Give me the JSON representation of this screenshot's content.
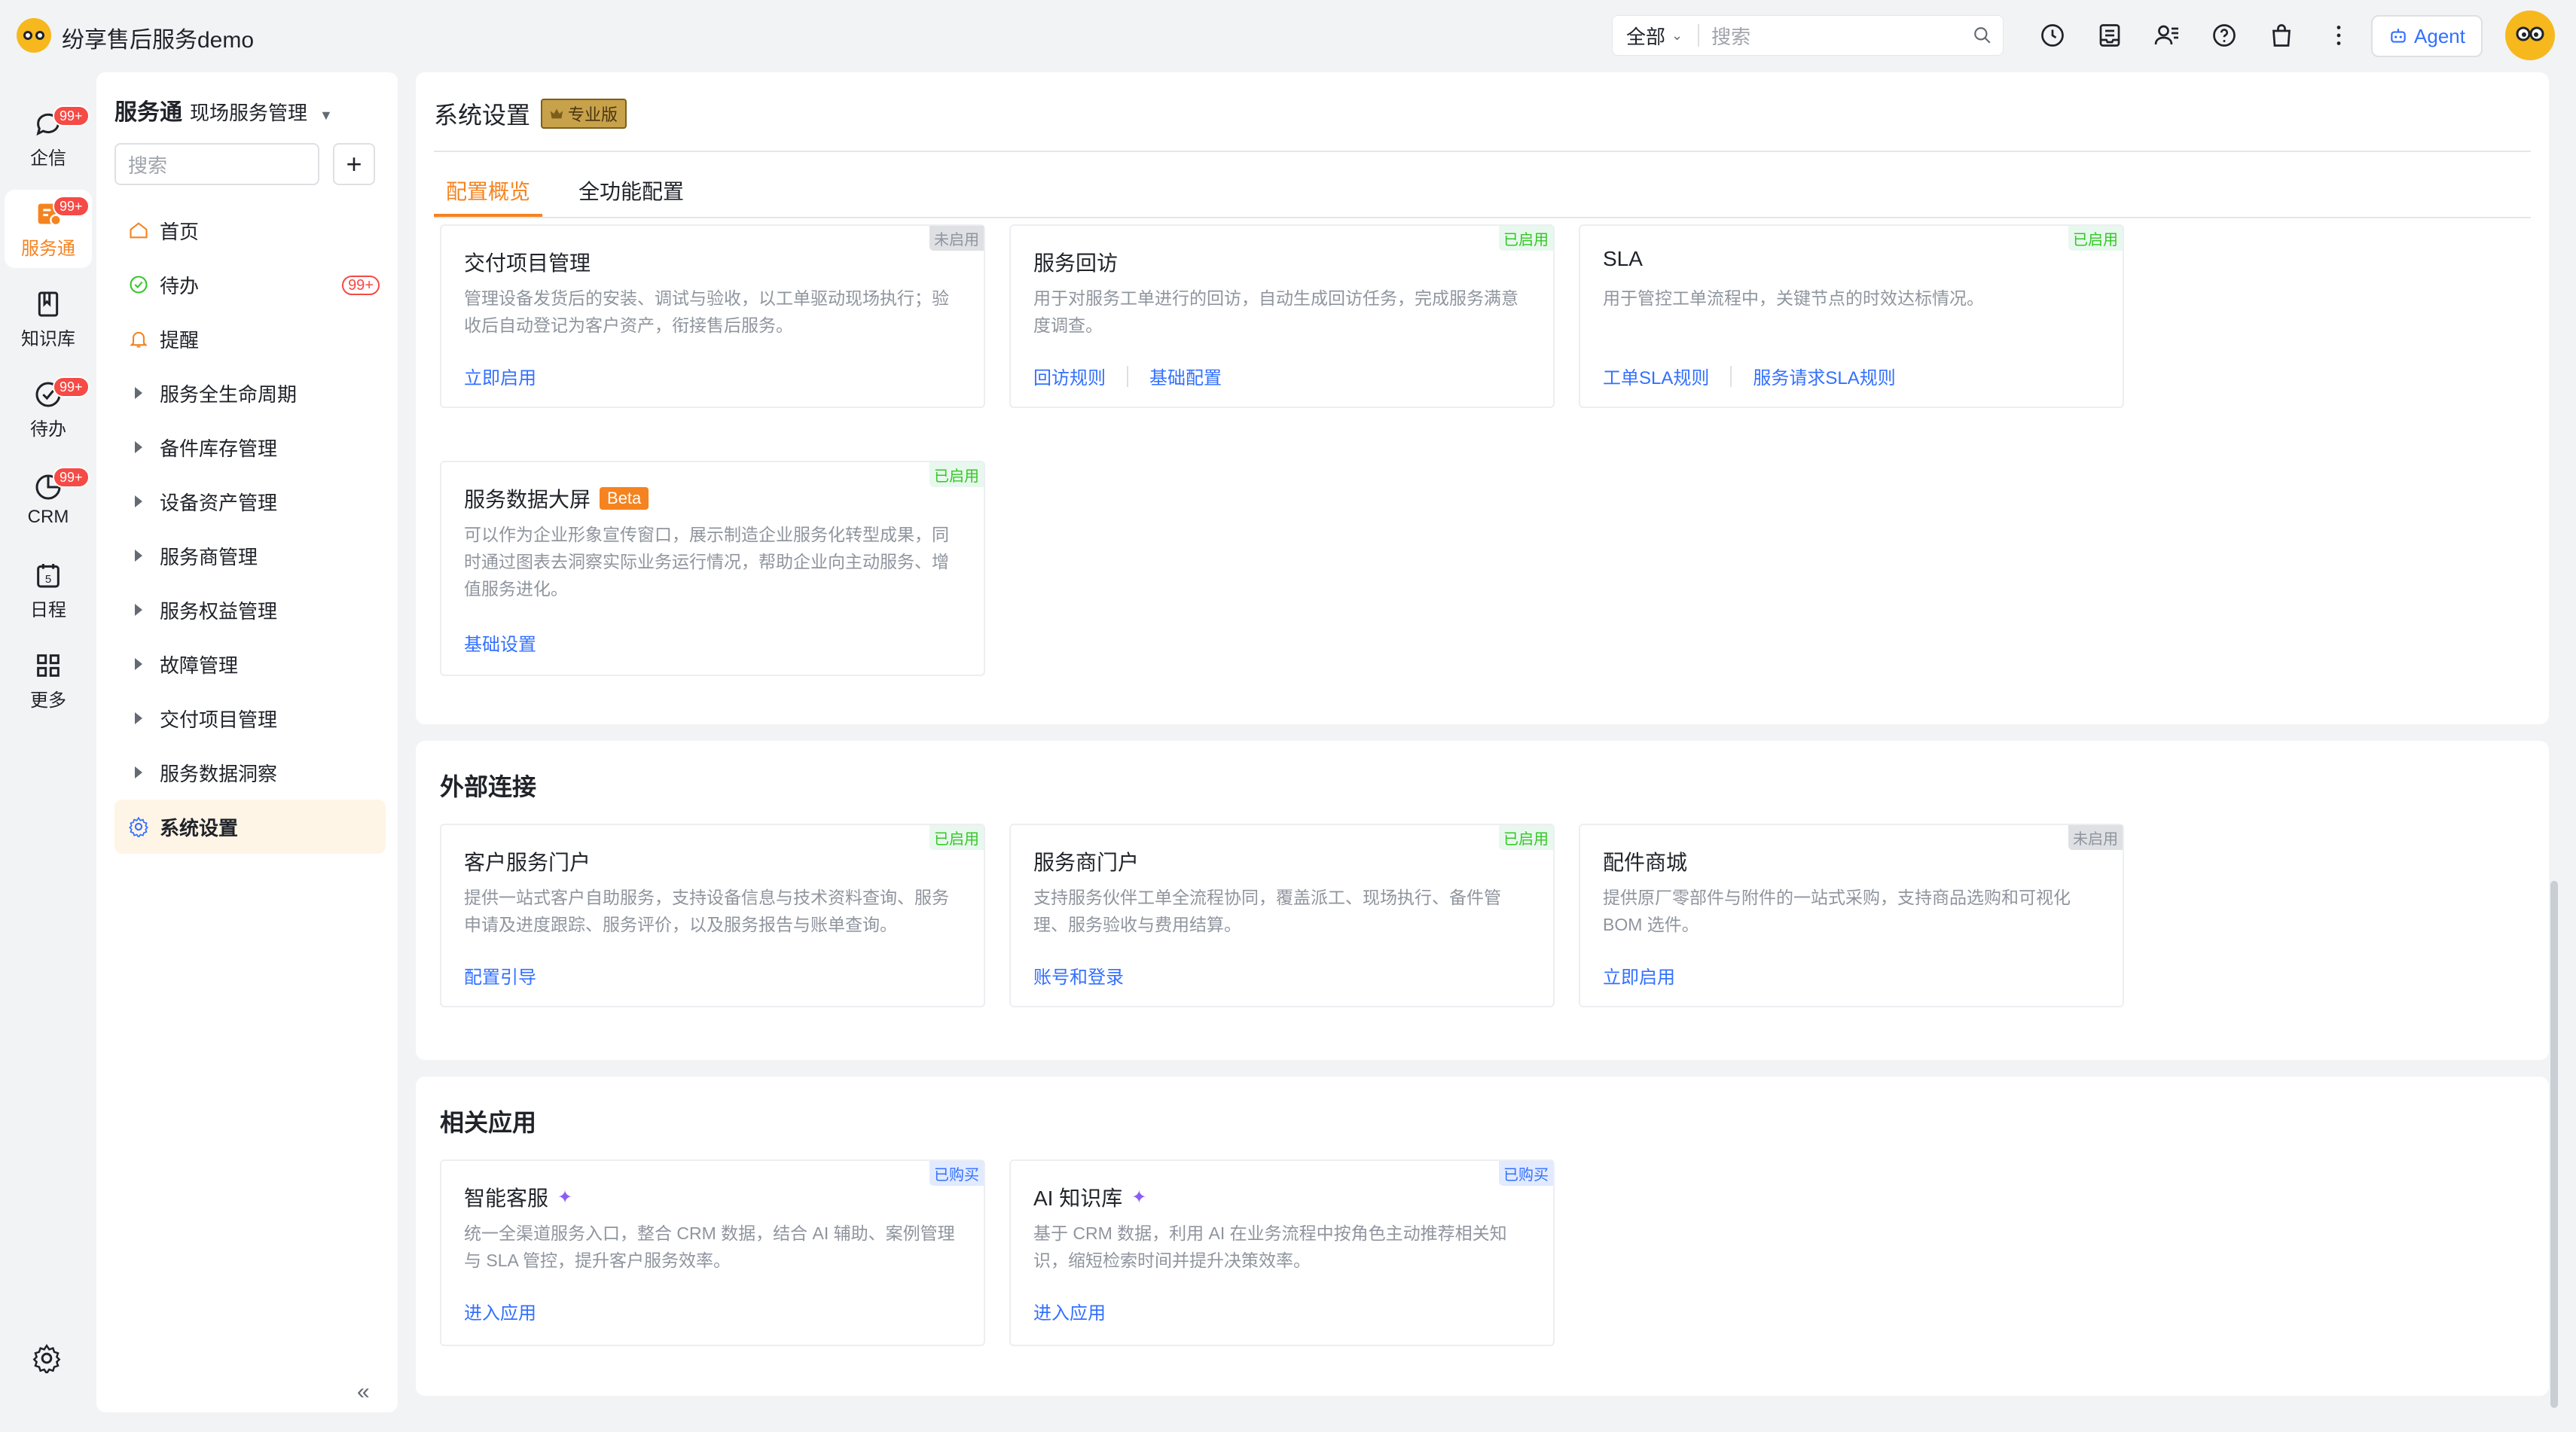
{
  "app": {
    "title": "纷享售后服务demo"
  },
  "topbar": {
    "search_scope": "全部",
    "search_placeholder": "搜索",
    "agent_label": "Agent"
  },
  "rail": {
    "items": [
      {
        "label": "企信",
        "badge": "99+",
        "icon": "chat-icon"
      },
      {
        "label": "服务通",
        "badge": "99+",
        "icon": "service-icon",
        "active": true
      },
      {
        "label": "知识库",
        "icon": "book-icon"
      },
      {
        "label": "待办",
        "badge": "99+",
        "icon": "check-circle-icon"
      },
      {
        "label": "CRM",
        "badge": "99+",
        "icon": "crm-icon"
      },
      {
        "label": "日程",
        "icon": "calendar-icon"
      },
      {
        "label": "更多",
        "icon": "grid-icon"
      }
    ],
    "calendar_day": "5"
  },
  "sidebar": {
    "title": "服务通",
    "subtitle": "现场服务管理",
    "search_placeholder": "搜索",
    "items": [
      {
        "label": "首页"
      },
      {
        "label": "待办",
        "badge": "99+"
      },
      {
        "label": "提醒"
      },
      {
        "label": "服务全生命周期"
      },
      {
        "label": "备件库存管理"
      },
      {
        "label": "设备资产管理"
      },
      {
        "label": "服务商管理"
      },
      {
        "label": "服务权益管理"
      },
      {
        "label": "故障管理"
      },
      {
        "label": "交付项目管理"
      },
      {
        "label": "服务数据洞察"
      },
      {
        "label": "系统设置"
      }
    ]
  },
  "main": {
    "page_title": "系统设置",
    "edition_badge": "专业版",
    "tabs": [
      {
        "label": "配置概览"
      },
      {
        "label": "全功能配置"
      }
    ],
    "top_cards": [
      {
        "title": "交付项目管理",
        "status": "未启用",
        "desc": "管理设备发货后的安装、调试与验收，以工单驱动现场执行；验收后自动登记为客户资产，衔接售后服务。",
        "links": [
          "立即启用"
        ]
      },
      {
        "title": "服务回访",
        "status": "已启用",
        "desc": "用于对服务工单进行的回访，自动生成回访任务，完成服务满意度调查。",
        "links": [
          "回访规则",
          "基础配置"
        ]
      },
      {
        "title": "SLA",
        "status": "已启用",
        "desc": "用于管控工单流程中，关键节点的时效达标情况。",
        "links": [
          "工单SLA规则",
          "服务请求SLA规则"
        ]
      },
      {
        "title": "服务数据大屏",
        "beta": "Beta",
        "status": "已启用",
        "desc": "可以作为企业形象宣传窗口，展示制造企业服务化转型成果，同时通过图表去洞察实际业务运行情况，帮助企业向主动服务、增值服务进化。",
        "links": [
          "基础设置"
        ]
      }
    ],
    "external": {
      "title": "外部连接",
      "cards": [
        {
          "title": "客户服务门户",
          "status": "已启用",
          "desc": "提供一站式客户自助服务，支持设备信息与技术资料查询、服务申请及进度跟踪、服务评价，以及服务报告与账单查询。",
          "links": [
            "配置引导"
          ]
        },
        {
          "title": "服务商门户",
          "status": "已启用",
          "desc": "支持服务伙伴工单全流程协同，覆盖派工、现场执行、备件管理、服务验收与费用结算。",
          "links": [
            "账号和登录"
          ]
        },
        {
          "title": "配件商城",
          "status": "未启用",
          "desc": "提供原厂零部件与附件的一站式采购，支持商品选购和可视化BOM 选件。",
          "links": [
            "立即启用"
          ]
        }
      ]
    },
    "related": {
      "title": "相关应用",
      "cards": [
        {
          "title": "智能客服",
          "status": "已购买",
          "desc": "统一全渠道服务入口，整合 CRM 数据，结合 AI 辅助、案例管理与 SLA 管控，提升客户服务效率。",
          "links": [
            "进入应用"
          ]
        },
        {
          "title": "AI 知识库",
          "status": "已购买",
          "desc": "基于 CRM 数据，利用 AI 在业务流程中按角色主动推荐相关知识，缩短检索时间并提升决策效率。",
          "links": [
            "进入应用"
          ]
        }
      ]
    }
  }
}
